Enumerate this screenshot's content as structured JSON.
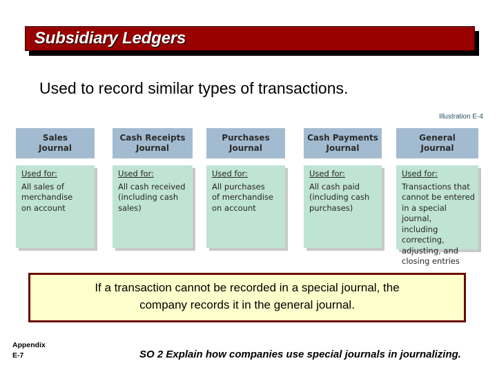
{
  "title": "Subsidiary Ledgers",
  "subtitle": "Used to record similar types of transactions.",
  "illustration_label": "Illustration E-4",
  "journals": [
    {
      "name_line1": "Sales",
      "name_line2": "Journal",
      "used_for_label": "Used for:",
      "description": "All sales of\nmerchandise\non account"
    },
    {
      "name_line1": "Cash Receipts",
      "name_line2": "Journal",
      "used_for_label": "Used for:",
      "description": "All cash received\n(including cash\nsales)"
    },
    {
      "name_line1": "Purchases",
      "name_line2": "Journal",
      "used_for_label": "Used for:",
      "description": "All purchases\nof merchandise\non account"
    },
    {
      "name_line1": "Cash Payments",
      "name_line2": "Journal",
      "used_for_label": "Used for:",
      "description": "All cash paid\n(including cash\npurchases)"
    },
    {
      "name_line1": "General",
      "name_line2": "Journal",
      "used_for_label": "Used for:",
      "description": "Transactions that\ncannot be entered\nin a special journal,\nincluding correcting,\nadjusting, and\nclosing entries"
    }
  ],
  "note": {
    "line1": "If a transaction cannot be recorded in a special journal, the",
    "line2": "company records it in the general journal."
  },
  "footer": {
    "appendix_line1": "Appendix",
    "appendix_line2": "E-7",
    "objective": "SO 2  Explain how companies use special journals in journalizing."
  },
  "colors": {
    "title_bar": "#990000",
    "journal_header": "#a3bbd0",
    "journal_body": "#bfe3d4",
    "note_bg": "#ffffcc",
    "note_border": "#6b0000"
  }
}
